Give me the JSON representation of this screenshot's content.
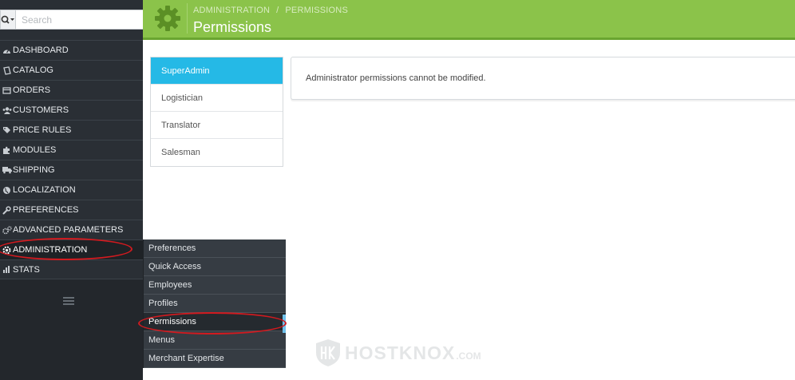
{
  "search": {
    "placeholder": "Search"
  },
  "sidebar": {
    "items": [
      {
        "label": "DASHBOARD",
        "icon": "dashboard-icon"
      },
      {
        "label": "CATALOG",
        "icon": "catalog-icon"
      },
      {
        "label": "ORDERS",
        "icon": "orders-icon"
      },
      {
        "label": "CUSTOMERS",
        "icon": "customers-icon"
      },
      {
        "label": "PRICE RULES",
        "icon": "tags-icon"
      },
      {
        "label": "MODULES",
        "icon": "puzzle-icon"
      },
      {
        "label": "SHIPPING",
        "icon": "truck-icon"
      },
      {
        "label": "LOCALIZATION",
        "icon": "globe-icon"
      },
      {
        "label": "PREFERENCES",
        "icon": "wrench-icon"
      },
      {
        "label": "ADVANCED PARAMETERS",
        "icon": "cogs-icon"
      },
      {
        "label": "ADMINISTRATION",
        "icon": "admin-icon"
      },
      {
        "label": "STATS",
        "icon": "stats-icon"
      }
    ]
  },
  "submenu": {
    "items": [
      {
        "label": "Preferences"
      },
      {
        "label": "Quick Access"
      },
      {
        "label": "Employees"
      },
      {
        "label": "Profiles"
      },
      {
        "label": "Permissions"
      },
      {
        "label": "Menus"
      },
      {
        "label": "Merchant Expertise"
      }
    ]
  },
  "header": {
    "breadcrumb": [
      "ADMINISTRATION",
      "PERMISSIONS"
    ],
    "separator": "/",
    "title": "Permissions"
  },
  "roles": {
    "items": [
      {
        "label": "SuperAdmin"
      },
      {
        "label": "Logistician"
      },
      {
        "label": "Translator"
      },
      {
        "label": "Salesman"
      }
    ]
  },
  "panel": {
    "message": "Administrator permissions cannot be modified."
  },
  "watermark": {
    "brand": "HOSTKNOX",
    "suffix": ".COM"
  },
  "colors": {
    "header_bg": "#8bc34a",
    "sidebar_bg": "#2a2f35",
    "active_role": "#25b9e6",
    "annotation": "#d21a1f"
  }
}
